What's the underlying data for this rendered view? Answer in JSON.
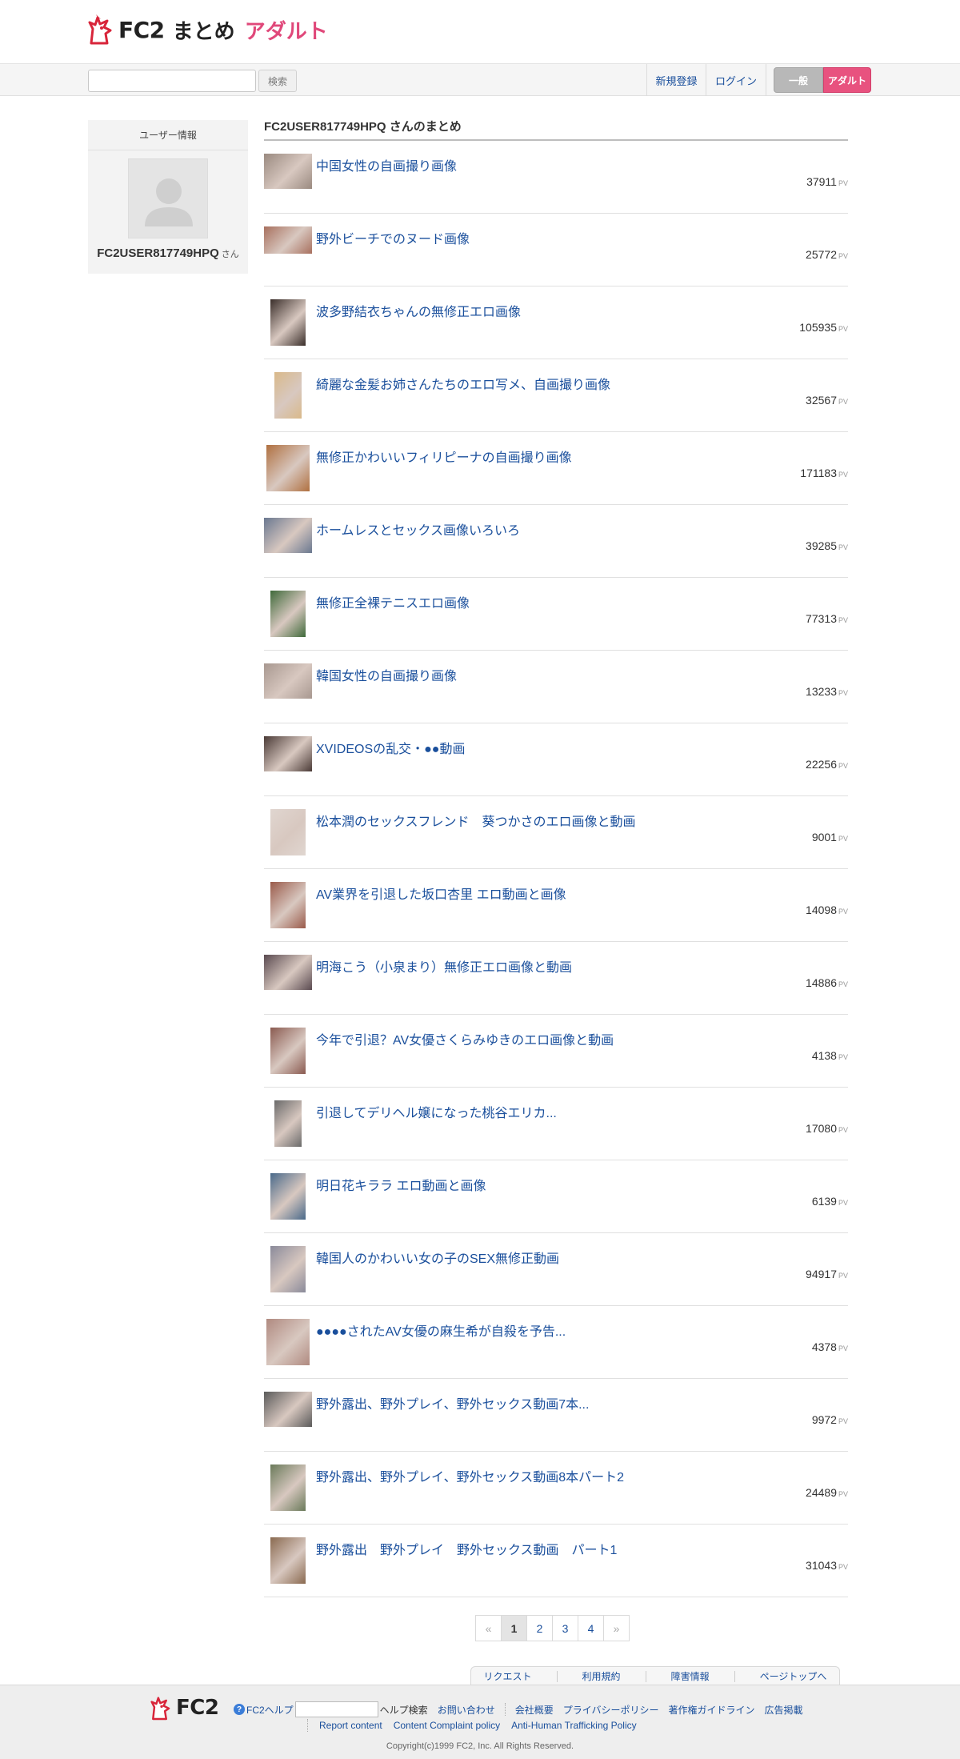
{
  "header": {
    "logo_fc2": "FC2",
    "logo_matome": "まとめ",
    "logo_adult": "アダルト"
  },
  "toolbar": {
    "search_value": "",
    "search_button": "検索",
    "register": "新規登録",
    "login": "ログイン",
    "general": "一般",
    "adult": "アダルト"
  },
  "sidebar": {
    "heading": "ユーザー情報",
    "username": "FC2USER817749HPQ",
    "san": "さん"
  },
  "main": {
    "title": "FC2USER817749HPQ さんのまとめ",
    "pv_unit": "PV",
    "items": [
      {
        "title": "中国女性の自画撮り画像",
        "pv": "37911",
        "thumb_color": "#9a8a80",
        "thumb_shape": "wide"
      },
      {
        "title": "野外ビーチでのヌード画像",
        "pv": "25772",
        "thumb_color": "#a8705e",
        "thumb_shape": "short"
      },
      {
        "title": "波多野結衣ちゃんの無修正エロ画像",
        "pv": "105935",
        "thumb_color": "#3a2e2a",
        "thumb_shape": "tall"
      },
      {
        "title": "綺麗な金髪お姉さんたちのエロ写メ、自画撮り画像",
        "pv": "32567",
        "thumb_color": "#d9b98a",
        "thumb_shape": "narrow"
      },
      {
        "title": "無修正かわいいフィリピーナの自画撮り画像",
        "pv": "171183",
        "thumb_color": "#b07040",
        "thumb_shape": "square"
      },
      {
        "title": "ホームレスとセックス画像いろいろ",
        "pv": "39285",
        "thumb_color": "#6a7890",
        "thumb_shape": "wide"
      },
      {
        "title": "無修正全裸テニスエロ画像",
        "pv": "77313",
        "thumb_color": "#3f6a3a",
        "thumb_shape": "tall"
      },
      {
        "title": "韓国女性の自画撮り画像",
        "pv": "13233",
        "thumb_color": "#a89890",
        "thumb_shape": "wide"
      },
      {
        "title": "XVIDEOSの乱交・●●動画",
        "pv": "22256",
        "thumb_color": "#4a3a36",
        "thumb_shape": "wide"
      },
      {
        "title": "松本潤のセックスフレンド　葵つかさのエロ画像と動画",
        "pv": "9001",
        "thumb_color": "#e0d6d0",
        "thumb_shape": "tall"
      },
      {
        "title": "AV業界を引退した坂口杏里 エロ動画と画像",
        "pv": "14098",
        "thumb_color": "#9a5a4a",
        "thumb_shape": "tall"
      },
      {
        "title": "明海こう（小泉まり）無修正エロ画像と動画",
        "pv": "14886",
        "thumb_color": "#5a4a50",
        "thumb_shape": "wide"
      },
      {
        "title": "今年で引退？AV女優さくらみゆきのエロ画像と動画",
        "pv": "4138",
        "thumb_color": "#8a5a50",
        "thumb_shape": "tall"
      },
      {
        "title": "引退してデリヘル嬢になった桃谷エリカ...",
        "pv": "17080",
        "thumb_color": "#6a6a6a",
        "thumb_shape": "narrow"
      },
      {
        "title": "明日花キララ エロ動画と画像",
        "pv": "6139",
        "thumb_color": "#4a6a8a",
        "thumb_shape": "tall"
      },
      {
        "title": "韓国人のかわいい女の子のSEX無修正動画",
        "pv": "94917",
        "thumb_color": "#8a8a9a",
        "thumb_shape": "tall"
      },
      {
        "title": "●●●●されたAV女優の麻生希が自殺を予告...",
        "pv": "4378",
        "thumb_color": "#b08a80",
        "thumb_shape": "square"
      },
      {
        "title": "野外露出、野外プレイ、野外セックス動画7本...",
        "pv": "9972",
        "thumb_color": "#5a5a5a",
        "thumb_shape": "wide"
      },
      {
        "title": "野外露出、野外プレイ、野外セックス動画8本パート2",
        "pv": "24489",
        "thumb_color": "#6a7a5a",
        "thumb_shape": "tall"
      },
      {
        "title": "野外露出　野外プレイ　野外セックス動画　パート1",
        "pv": "31043",
        "thumb_color": "#8a6a50",
        "thumb_shape": "tall"
      }
    ]
  },
  "pagination": {
    "prev": "«",
    "pages": [
      "1",
      "2",
      "3",
      "4"
    ],
    "next": "»",
    "current": "1"
  },
  "footer": {
    "tabs": [
      "リクエスト",
      "利用規約",
      "障害情報",
      "ページトップへ"
    ],
    "logo": "FC2",
    "help_icon": "?",
    "help": "FC2ヘルプ",
    "help_search": "ヘルプ検索",
    "contact": "お問い合わせ",
    "links1": [
      "会社概要",
      "プライバシーポリシー",
      "著作権ガイドライン",
      "広告掲載"
    ],
    "links2": [
      "Report content",
      "Content Complaint policy",
      "Anti-Human Trafficking Policy"
    ],
    "copyright": "Copyright(c)1999 FC2, Inc. All Rights Reserved."
  },
  "colors": {
    "link": "#1a4f9c",
    "adult_pink": "#e8527f",
    "logo_red": "#d8253a"
  }
}
